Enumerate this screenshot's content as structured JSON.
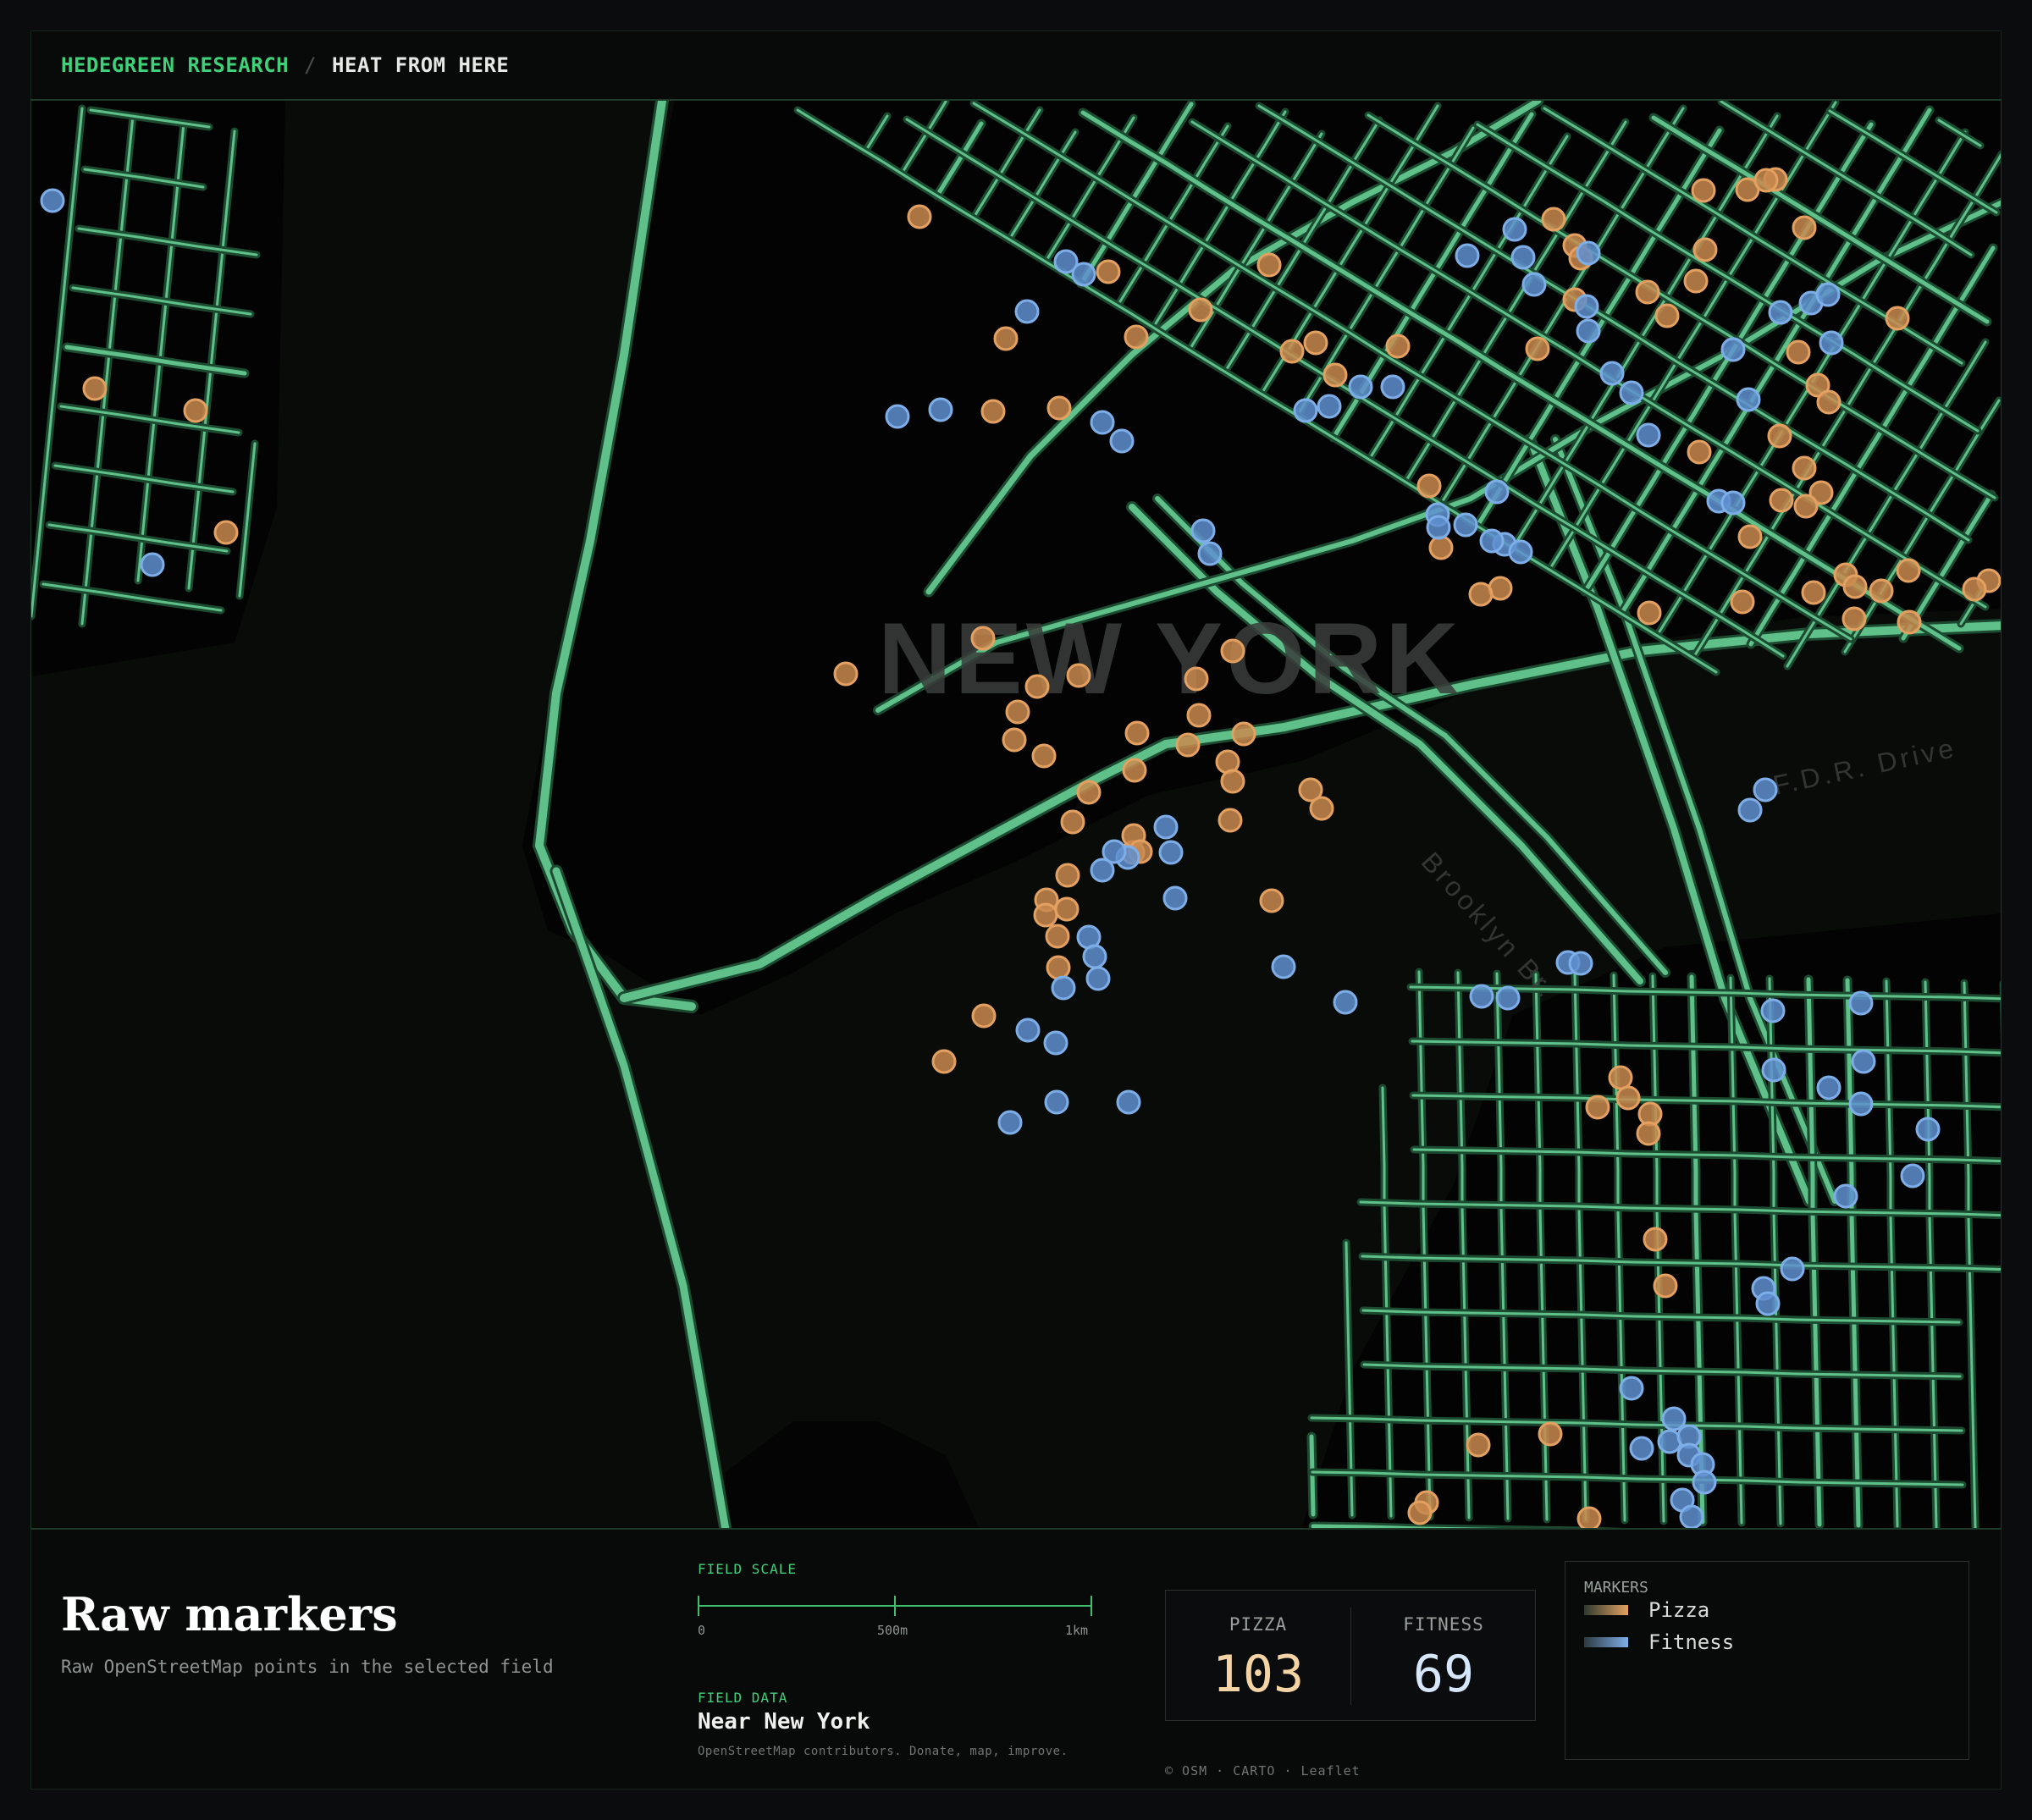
{
  "header": {
    "brand": "HEDEGREEN RESEARCH",
    "separator": "/",
    "page": "HEAT FROM HERE"
  },
  "map": {
    "place_labels": [
      "NEW YORK",
      "F.D.R. Drive",
      "Brooklyn Br."
    ],
    "colors": {
      "road": "#5fc08a",
      "road_glow": "#1c4a30",
      "pizza": "#e3a060",
      "fitness": "#7eaee8"
    }
  },
  "panel": {
    "title": "Raw markers",
    "subtitle": "Raw OpenStreetMap points in the selected field",
    "field_scale_label": "FIELD SCALE",
    "scale_ticks": [
      "0",
      "500m",
      "1km"
    ],
    "field_data_label": "FIELD DATA",
    "field_data_value": "Near New York",
    "field_data_note": "OpenStreetMap contributors. Donate, map, improve.",
    "stats": [
      {
        "label": "PIZZA",
        "value": "103",
        "color": "#f4d3a4"
      },
      {
        "label": "FITNESS",
        "value": "69",
        "color": "#d6e6fb"
      }
    ],
    "attribution": "© OSM · CARTO · Leaflet",
    "legend": {
      "title": "MARKERS",
      "items": [
        {
          "label": "Pizza",
          "color": "#e3a060"
        },
        {
          "label": "Fitness",
          "color": "#7eaee8"
        }
      ]
    }
  }
}
